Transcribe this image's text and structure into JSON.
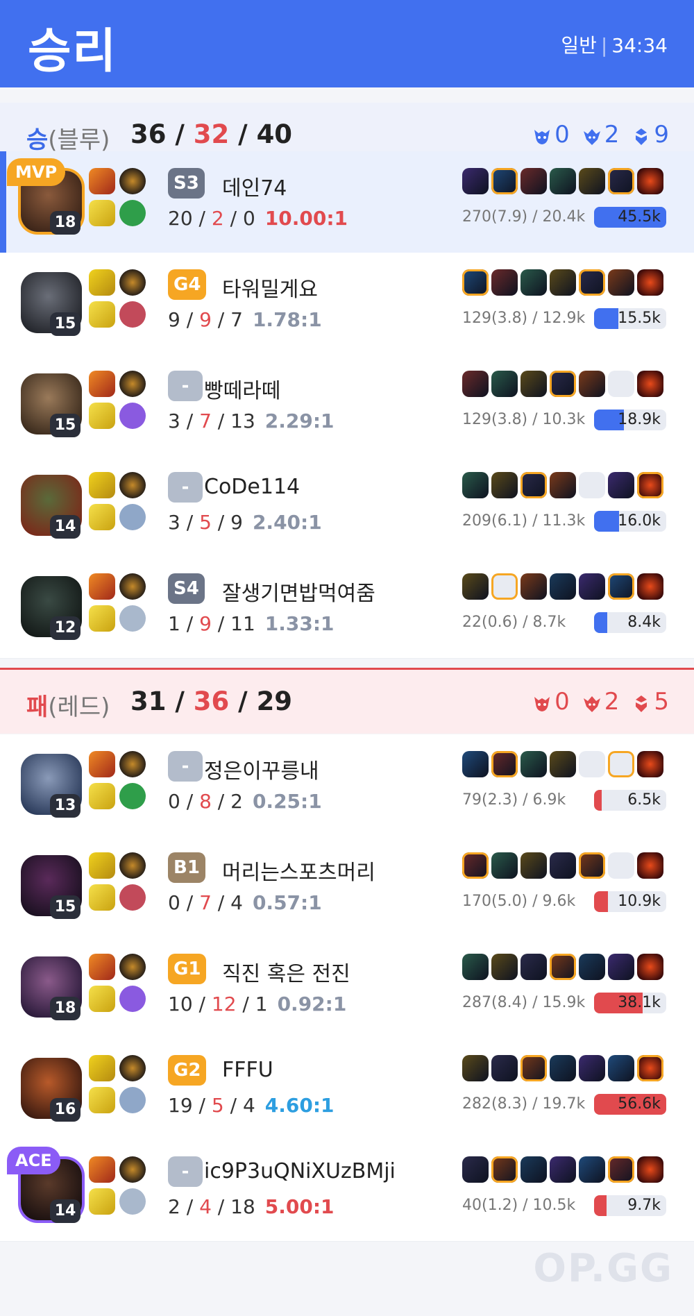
{
  "header": {
    "result": "승리",
    "mode": "일반",
    "duration": "34:34"
  },
  "teams": [
    {
      "result": "승",
      "side": "(블루)",
      "kills": "36",
      "deaths": "32",
      "assists": "40",
      "objectives": [
        {
          "icon": "baron-icon",
          "count": "0"
        },
        {
          "icon": "dragon-icon",
          "count": "2"
        },
        {
          "icon": "tower-icon",
          "count": "9"
        }
      ],
      "players": [
        {
          "level": "18",
          "tier": "S3",
          "tier_color": "#6b7487",
          "name": "데인74",
          "k": "20",
          "d": "2",
          "a": "0",
          "ratio": "10.00:1",
          "ratio_color": "#e14a4e",
          "stats": "270(7.9) / 20.4k",
          "damage": "45.5k",
          "damage_frac": 1.0,
          "badge": "MVP"
        },
        {
          "level": "15",
          "tier": "G4",
          "tier_color": "#f6a623",
          "name": "타워밀게요",
          "k": "9",
          "d": "9",
          "a": "7",
          "ratio": "1.78:1",
          "ratio_color": "#8a93a5",
          "stats": "129(3.8) / 12.9k",
          "damage": "15.5k",
          "damage_frac": 0.34,
          "badge": ""
        },
        {
          "level": "15",
          "tier": "-",
          "tier_color": "#b3bccb",
          "name": "빵떼라떼",
          "k": "3",
          "d": "7",
          "a": "13",
          "ratio": "2.29:1",
          "ratio_color": "#8a93a5",
          "stats": "129(3.8) / 10.3k",
          "damage": "18.9k",
          "damage_frac": 0.41,
          "badge": ""
        },
        {
          "level": "14",
          "tier": "-",
          "tier_color": "#b3bccb",
          "name": "CoDe114",
          "k": "3",
          "d": "5",
          "a": "9",
          "ratio": "2.40:1",
          "ratio_color": "#8a93a5",
          "stats": "209(6.1) / 11.3k",
          "damage": "16.0k",
          "damage_frac": 0.35,
          "badge": ""
        },
        {
          "level": "12",
          "tier": "S4",
          "tier_color": "#6b7487",
          "name": "잘생기면밥먹여줌",
          "k": "1",
          "d": "9",
          "a": "11",
          "ratio": "1.33:1",
          "ratio_color": "#8a93a5",
          "stats": "22(0.6) / 8.7k",
          "damage": "8.4k",
          "damage_frac": 0.18,
          "badge": ""
        }
      ]
    },
    {
      "result": "패",
      "side": "(레드)",
      "kills": "31",
      "deaths": "36",
      "assists": "29",
      "objectives": [
        {
          "icon": "baron-icon",
          "count": "0"
        },
        {
          "icon": "dragon-icon",
          "count": "2"
        },
        {
          "icon": "tower-icon",
          "count": "5"
        }
      ],
      "players": [
        {
          "level": "13",
          "tier": "-",
          "tier_color": "#b3bccb",
          "name": "정은이꾸릉내",
          "k": "0",
          "d": "8",
          "a": "2",
          "ratio": "0.25:1",
          "ratio_color": "#8a93a5",
          "stats": "79(2.3) / 6.9k",
          "damage": "6.5k",
          "damage_frac": 0.11,
          "badge": ""
        },
        {
          "level": "15",
          "tier": "B1",
          "tier_color": "#9c8466",
          "name": "머리는스포츠머리",
          "k": "0",
          "d": "7",
          "a": "4",
          "ratio": "0.57:1",
          "ratio_color": "#8a93a5",
          "stats": "170(5.0) / 9.6k",
          "damage": "10.9k",
          "damage_frac": 0.19,
          "badge": ""
        },
        {
          "level": "18",
          "tier": "G1",
          "tier_color": "#f6a623",
          "name": "직진 혹은 전진",
          "k": "10",
          "d": "12",
          "a": "1",
          "ratio": "0.92:1",
          "ratio_color": "#8a93a5",
          "stats": "287(8.4) / 15.9k",
          "damage": "38.1k",
          "damage_frac": 0.67,
          "badge": ""
        },
        {
          "level": "16",
          "tier": "G2",
          "tier_color": "#f6a623",
          "name": "FFFU",
          "k": "19",
          "d": "5",
          "a": "4",
          "ratio": "4.60:1",
          "ratio_color": "#2d9ee0",
          "stats": "282(8.3) / 19.7k",
          "damage": "56.6k",
          "damage_frac": 1.0,
          "badge": ""
        },
        {
          "level": "14",
          "tier": "-",
          "tier_color": "#b3bccb",
          "name": "ic9P3uQNiXUzBMji",
          "k": "2",
          "d": "4",
          "a": "18",
          "ratio": "5.00:1",
          "ratio_color": "#e14a4e",
          "stats": "40(1.2) / 10.5k",
          "damage": "9.7k",
          "damage_frac": 0.17,
          "badge": "ACE"
        }
      ]
    }
  ],
  "footer": {
    "logo": "OP.GG"
  },
  "colors": {
    "blue": "#4170ef",
    "red": "#e14a4e"
  }
}
